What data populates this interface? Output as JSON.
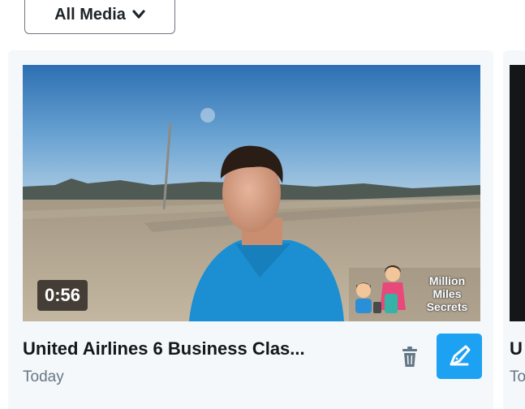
{
  "filter": {
    "label": "All Media"
  },
  "media_cards": [
    {
      "duration": "0:56",
      "title": "United Airlines 6 Business Clas...",
      "date": "Today",
      "watermark": "Million Miles Secrets"
    },
    {
      "title": "U",
      "date": "To"
    }
  ],
  "icons": {
    "filter_chevron": "chevron-down-icon",
    "delete": "trash-icon",
    "edit": "edit-pencil-icon"
  },
  "colors": {
    "accent": "#1da1f2",
    "card_bg": "#f5f8fa",
    "title_text": "#14171a",
    "secondary_text": "#657786"
  }
}
